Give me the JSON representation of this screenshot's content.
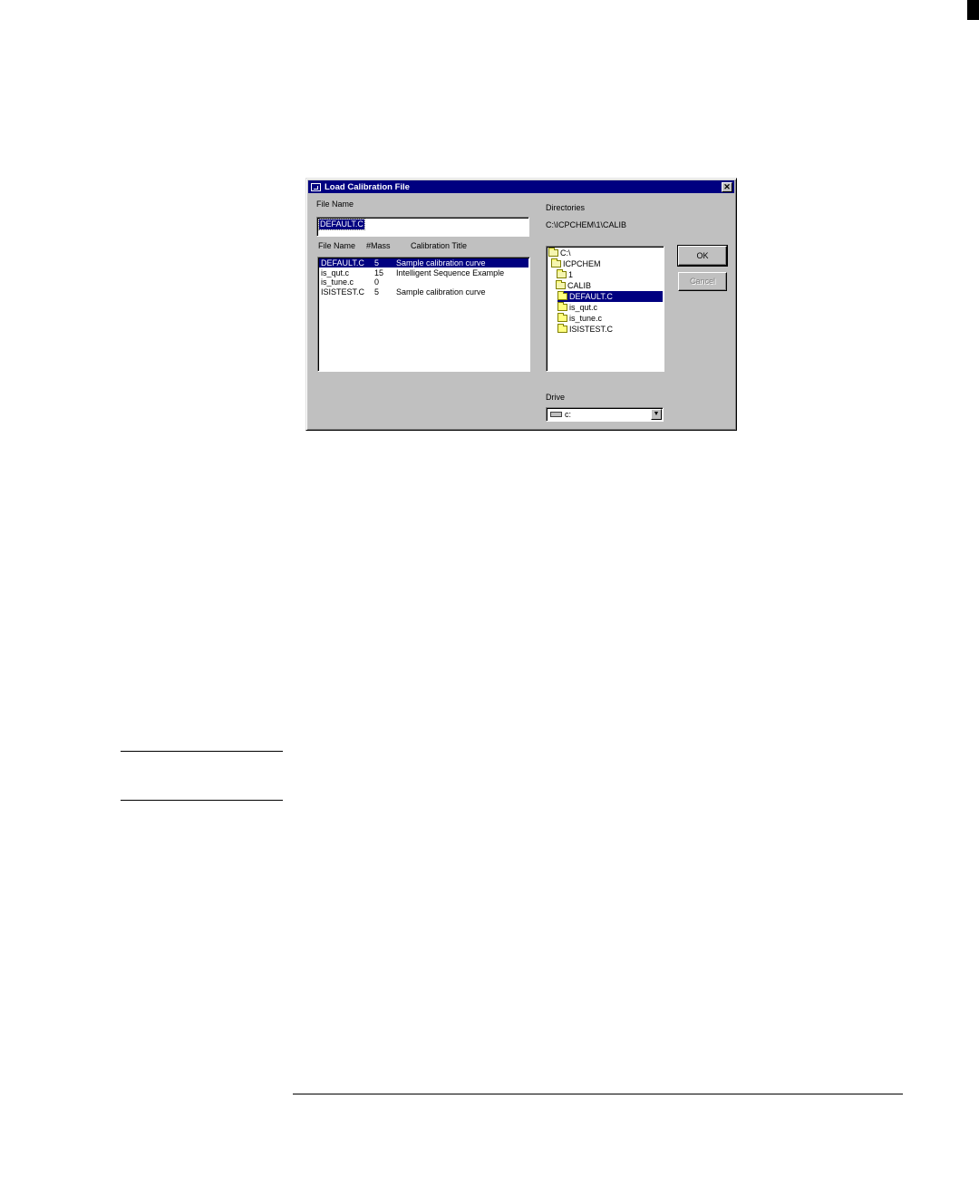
{
  "dialog": {
    "title": "Load Calibration File",
    "close_glyph": "✕",
    "file_name_label": "File Name",
    "file_name_value": "DEFAULT.C",
    "columns": [
      "File Name",
      "#Mass",
      "Calibration Title"
    ],
    "files": [
      {
        "name": "DEFAULT.C",
        "mass": "5",
        "title": "Sample calibration curve",
        "selected": true
      },
      {
        "name": "is_qut.c",
        "mass": "15",
        "title": "Intelligent Sequence Example",
        "selected": false
      },
      {
        "name": "is_tune.c",
        "mass": "0",
        "title": "",
        "selected": false
      },
      {
        "name": "ISISTEST.C",
        "mass": "5",
        "title": "Sample calibration curve",
        "selected": false
      }
    ],
    "directories_label": "Directories",
    "directory_path": "C:\\ICPCHEM\\1\\CALIB",
    "directory_tree": [
      {
        "label": "C:\\",
        "icon": "open-folder-icon",
        "selected": false
      },
      {
        "label": "ICPCHEM",
        "icon": "open-folder-icon",
        "selected": false
      },
      {
        "label": "1",
        "icon": "open-folder-icon",
        "selected": false
      },
      {
        "label": "CALIB",
        "icon": "open-folder-icon",
        "selected": false
      },
      {
        "label": "DEFAULT.C",
        "icon": "folder-icon",
        "selected": true
      },
      {
        "label": "is_qut.c",
        "icon": "folder-icon",
        "selected": false
      },
      {
        "label": "is_tune.c",
        "icon": "folder-icon",
        "selected": false
      },
      {
        "label": "ISISTEST.C",
        "icon": "folder-icon",
        "selected": false
      }
    ],
    "ok_label": "OK",
    "cancel_label": "Cancel",
    "drive_label": "Drive",
    "drive_value": "c:",
    "drive_icon": "drive-icon",
    "dropdown_glyph": "▼"
  },
  "colors": {
    "selection": "#000080",
    "dialog_face": "#c0c0c0",
    "title_bar": "#000080"
  }
}
